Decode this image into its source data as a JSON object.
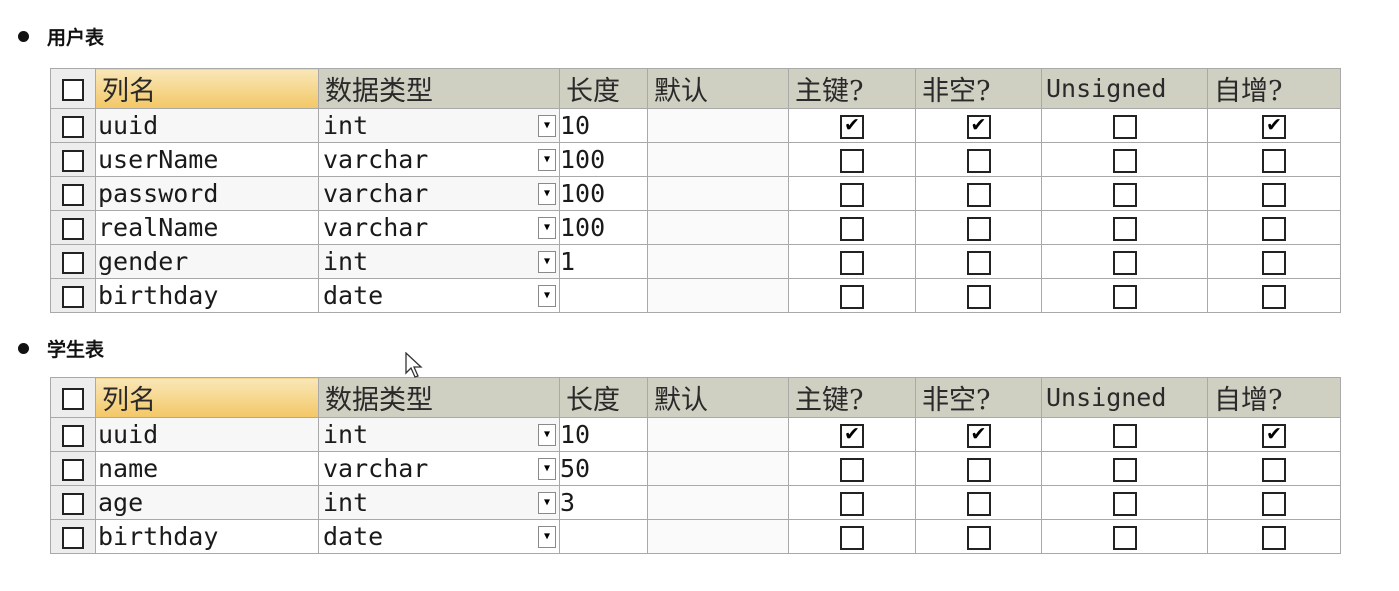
{
  "headers": {
    "col_name": "列名",
    "data_type": "数据类型",
    "length": "长度",
    "default": "默认",
    "primary_key": "主键?",
    "not_null": "非空?",
    "unsigned": "Unsigned",
    "auto_inc": "自增?"
  },
  "tables": [
    {
      "title": "用户表",
      "rows": [
        {
          "name": "uuid",
          "type": "int",
          "length": "10",
          "default": "",
          "pk": true,
          "not_null": true,
          "unsigned": false,
          "auto_inc": true
        },
        {
          "name": "userName",
          "type": "varchar",
          "length": "100",
          "default": "",
          "pk": false,
          "not_null": false,
          "unsigned": false,
          "auto_inc": false
        },
        {
          "name": "password",
          "type": "varchar",
          "length": "100",
          "default": "",
          "pk": false,
          "not_null": false,
          "unsigned": false,
          "auto_inc": false
        },
        {
          "name": "realName",
          "type": "varchar",
          "length": "100",
          "default": "",
          "pk": false,
          "not_null": false,
          "unsigned": false,
          "auto_inc": false
        },
        {
          "name": "gender",
          "type": "int",
          "length": "1",
          "default": "",
          "pk": false,
          "not_null": false,
          "unsigned": false,
          "auto_inc": false
        },
        {
          "name": "birthday",
          "type": "date",
          "length": "",
          "default": "",
          "pk": false,
          "not_null": false,
          "unsigned": false,
          "auto_inc": false
        }
      ]
    },
    {
      "title": "学生表",
      "rows": [
        {
          "name": "uuid",
          "type": "int",
          "length": "10",
          "default": "",
          "pk": true,
          "not_null": true,
          "unsigned": false,
          "auto_inc": true
        },
        {
          "name": "name",
          "type": "varchar",
          "length": "50",
          "default": "",
          "pk": false,
          "not_null": false,
          "unsigned": false,
          "auto_inc": false
        },
        {
          "name": "age",
          "type": "int",
          "length": "3",
          "default": "",
          "pk": false,
          "not_null": false,
          "unsigned": false,
          "auto_inc": false
        },
        {
          "name": "birthday",
          "type": "date",
          "length": "",
          "default": "",
          "pk": false,
          "not_null": false,
          "unsigned": false,
          "auto_inc": false
        }
      ]
    }
  ],
  "icons": {
    "bullet": "bullet-dot-icon",
    "dropdown": "chevron-down-icon",
    "checkbox": "checkbox-icon",
    "cursor": "mouse-pointer-icon"
  }
}
